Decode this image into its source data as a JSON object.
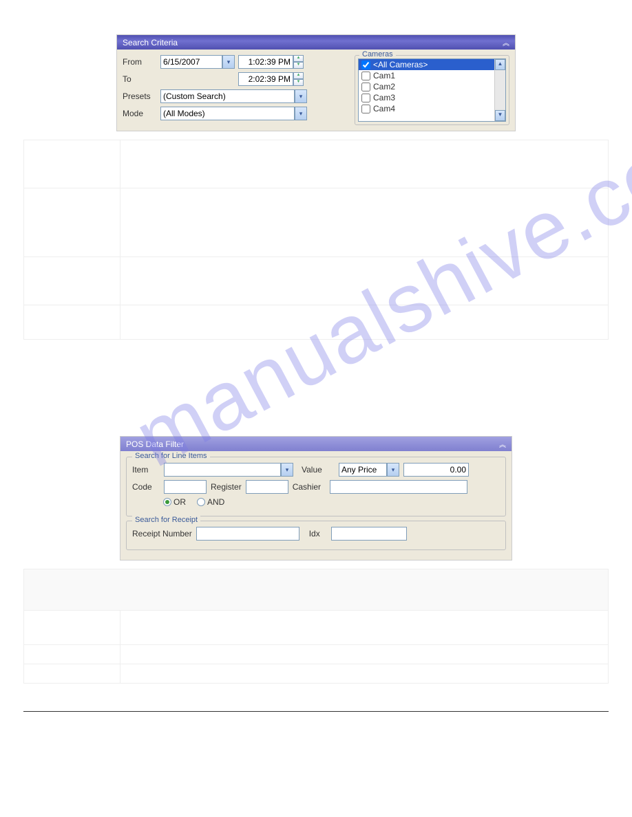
{
  "watermark": "manualshive.com",
  "searchCriteria": {
    "title": "Search Criteria",
    "labels": {
      "from": "From",
      "to": "To",
      "presets": "Presets",
      "mode": "Mode",
      "cameras": "Cameras"
    },
    "values": {
      "fromDate": "6/15/2007",
      "fromTime": "1:02:39 PM",
      "toTime": "2:02:39 PM",
      "presets": "(Custom Search)",
      "mode": "(All Modes)"
    },
    "cameras": [
      {
        "label": "<All Cameras>",
        "checked": true,
        "selected": true
      },
      {
        "label": "Cam1",
        "checked": false
      },
      {
        "label": "Cam2",
        "checked": false
      },
      {
        "label": "Cam3",
        "checked": false
      },
      {
        "label": "Cam4",
        "checked": false
      }
    ]
  },
  "table1": {
    "rows": [
      {
        "left": "",
        "right": ""
      },
      {
        "left": "",
        "right": ""
      },
      {
        "left": "",
        "right": ""
      },
      {
        "left": "",
        "right": ""
      }
    ]
  },
  "posFilter": {
    "title": "POS Data Filter",
    "group1": "Search for Line Items",
    "group2": "Search for Receipt",
    "labels": {
      "item": "Item",
      "value": "Value",
      "code": "Code",
      "register": "Register",
      "cashier": "Cashier",
      "or": "OR",
      "and": "AND",
      "receiptNumber": "Receipt Number",
      "idx": "Idx",
      "anyPrice": "Any Price",
      "priceVal": "0.00"
    }
  },
  "table2": {
    "headerRow": "",
    "rows": [
      {
        "left": "",
        "right": ""
      },
      {
        "left": "",
        "right": ""
      },
      {
        "left": "",
        "right": ""
      }
    ]
  }
}
